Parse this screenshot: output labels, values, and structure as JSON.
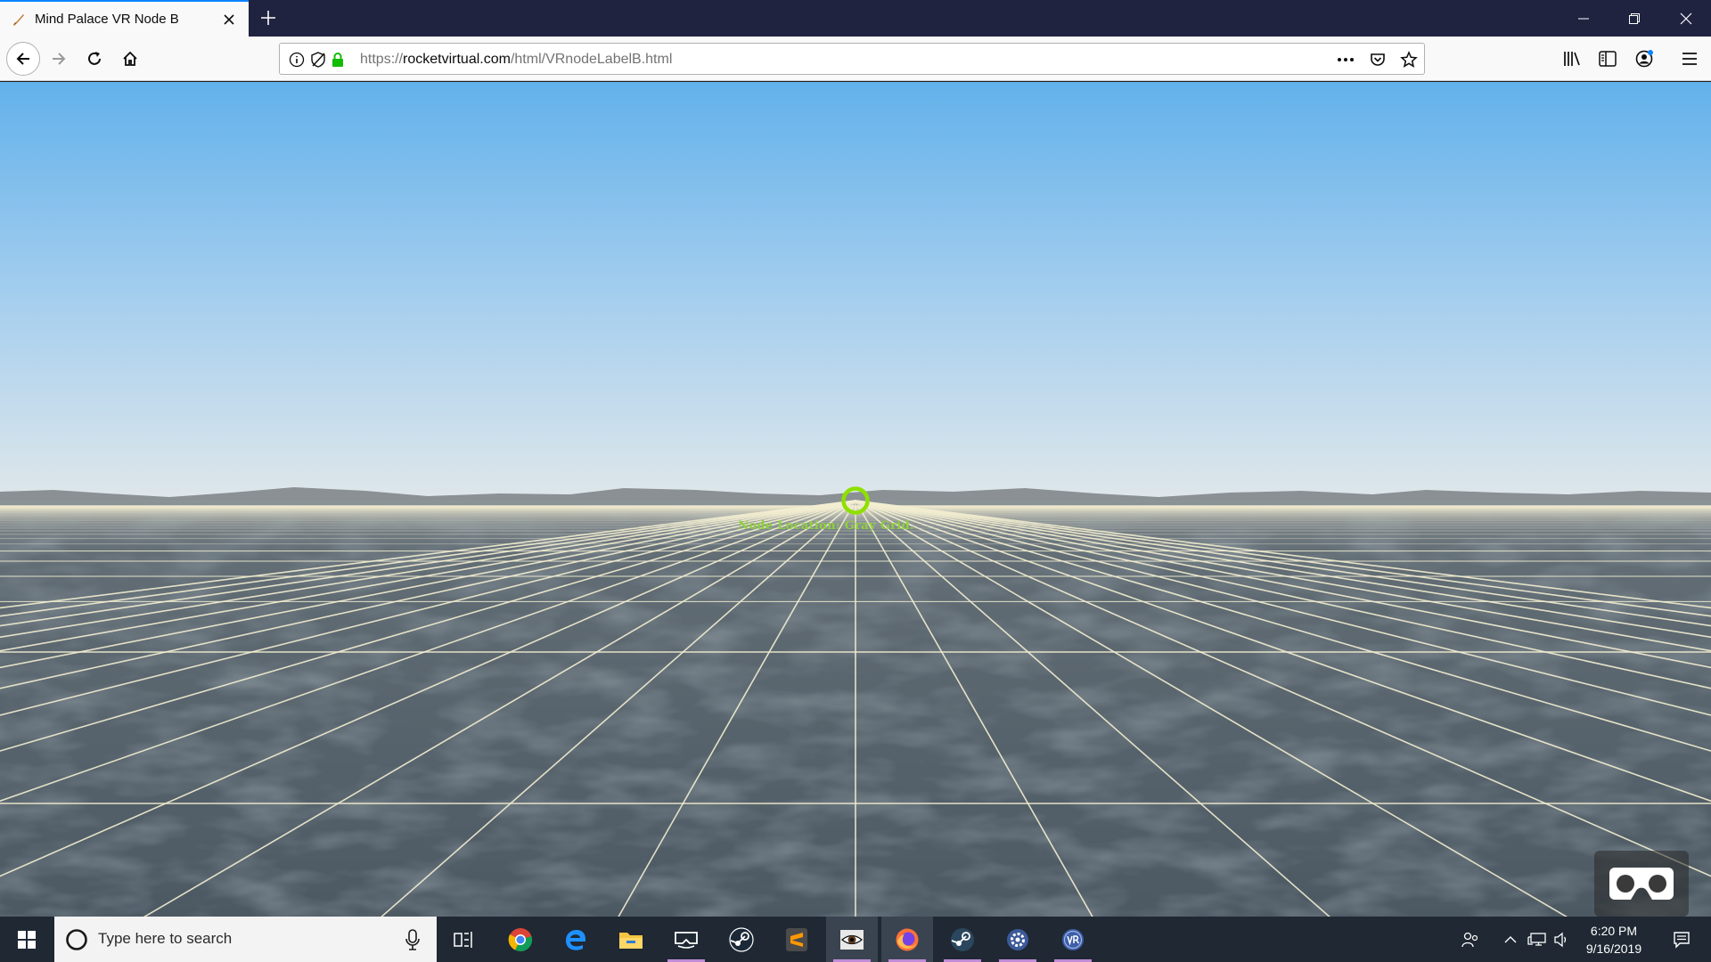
{
  "browser": {
    "tab": {
      "title": "Mind Palace VR Node B"
    },
    "url": {
      "prefix": "https://",
      "domain": "rocketvirtual.com",
      "path": "/html/VRnodeLabelB.html"
    },
    "accent_color": "#0a84ff"
  },
  "scene": {
    "node_label": "Node Location: Gray Grid.",
    "reticle_color": "#8ee000",
    "sky_top_color": "#62b1eb",
    "sky_horizon_color": "#dfe7ea",
    "ground_color": "#4c5963",
    "grid_line_color": "#f4efd2"
  },
  "taskbar": {
    "search_placeholder": "Type here to search",
    "apps": [
      "task-view",
      "chrome",
      "edge",
      "file-explorer",
      "vr-headset",
      "steam",
      "sublime-text",
      "eye-app",
      "firefox",
      "steam-vr",
      "settings-gear",
      "vr-app"
    ],
    "clock": {
      "time": "6:20 PM",
      "date": "9/16/2019"
    }
  }
}
